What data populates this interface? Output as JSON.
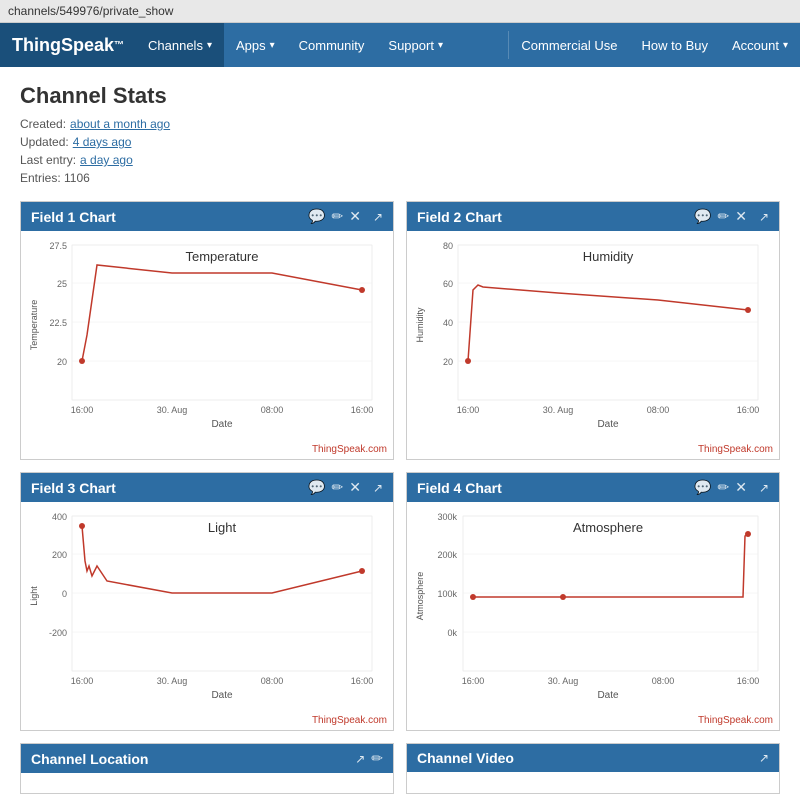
{
  "browser": {
    "url": "channels/549976/private_show"
  },
  "navbar": {
    "brand": "ThingSpeak",
    "brand_tm": "™",
    "items": [
      {
        "label": "Channels",
        "has_caret": true,
        "active": false
      },
      {
        "label": "Apps",
        "has_caret": true,
        "active": false
      },
      {
        "label": "Community",
        "has_caret": false,
        "active": false
      },
      {
        "label": "Support",
        "has_caret": true,
        "active": false
      }
    ],
    "right_items": [
      {
        "label": "Commercial Use"
      },
      {
        "label": "How to Buy"
      },
      {
        "label": "Account",
        "has_caret": true
      }
    ]
  },
  "page": {
    "title": "Channel Stats",
    "stats": [
      {
        "label": "Created:",
        "value": "about a month ago"
      },
      {
        "label": "Updated:",
        "value": "4 days ago"
      },
      {
        "label": "Last entry:",
        "value": "a day ago"
      },
      {
        "label": "Entries:",
        "value": "1106"
      }
    ]
  },
  "charts": [
    {
      "id": "field1",
      "title": "Field 1 Chart",
      "graph_title": "Temperature",
      "y_label": "Temperature",
      "x_label": "Date",
      "y_ticks": [
        "27.5",
        "25",
        "22.5",
        "20"
      ],
      "x_ticks": [
        "16:00",
        "30. Aug",
        "08:00",
        "16:00"
      ],
      "credit": "ThingSpeak.com"
    },
    {
      "id": "field2",
      "title": "Field 2 Chart",
      "graph_title": "Humidity",
      "y_label": "Humidity",
      "x_label": "Date",
      "y_ticks": [
        "80",
        "60",
        "40",
        "20"
      ],
      "x_ticks": [
        "16:00",
        "30. Aug",
        "08:00",
        "16:00"
      ],
      "credit": "ThingSpeak.com"
    },
    {
      "id": "field3",
      "title": "Field 3 Chart",
      "graph_title": "Light",
      "y_label": "Light",
      "x_label": "Date",
      "y_ticks": [
        "400",
        "200",
        "0",
        "-200"
      ],
      "x_ticks": [
        "16:00",
        "30. Aug",
        "08:00",
        "16:00"
      ],
      "credit": "ThingSpeak.com"
    },
    {
      "id": "field4",
      "title": "Field 4 Chart",
      "graph_title": "Atmosphere",
      "y_label": "Atmosphere",
      "x_label": "Date",
      "y_ticks": [
        "300k",
        "200k",
        "100k",
        "0k"
      ],
      "x_ticks": [
        "16:00",
        "30. Aug",
        "08:00",
        "16:00"
      ],
      "credit": "ThingSpeak.com"
    }
  ],
  "bottom_cards": [
    {
      "title": "Channel Location"
    },
    {
      "title": "Channel Video"
    }
  ],
  "icons": {
    "comment": "💬",
    "pencil": "✏",
    "close": "✕",
    "external": "↗"
  }
}
